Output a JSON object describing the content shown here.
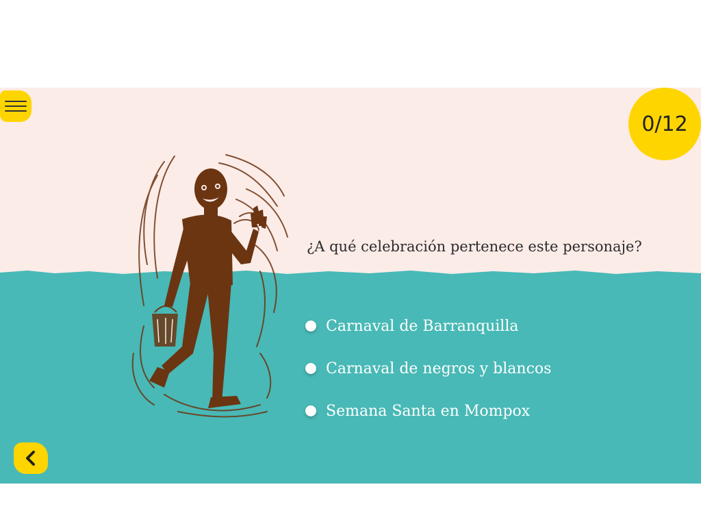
{
  "colors": {
    "top_background": "#fcece8",
    "bottom_background": "#48b9b6",
    "accent_yellow": "#ffd500",
    "figure_brown": "#6b3512"
  },
  "header": {
    "menu_icon": "hamburger-menu-icon",
    "score": "0/12"
  },
  "quiz": {
    "question": "¿A qué celebración pertenece este personaje?",
    "options": [
      {
        "label": "Carnaval de Barranquilla"
      },
      {
        "label": "Carnaval de negros y blancos"
      },
      {
        "label": "Semana Santa en Mompox"
      }
    ]
  },
  "footer": {
    "back_icon": "chevron-left-icon"
  }
}
